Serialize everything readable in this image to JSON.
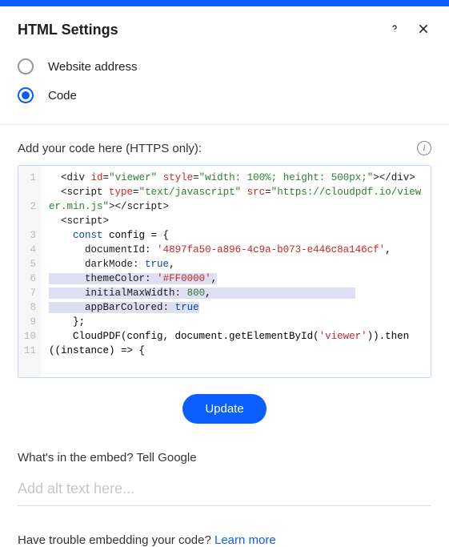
{
  "header": {
    "title": "HTML Settings"
  },
  "source": {
    "website_label": "Website address",
    "code_label": "Code",
    "selected": "code"
  },
  "code_section": {
    "label": "Add your code here (HTTPS only):"
  },
  "code_values": {
    "div_id": "viewer",
    "div_style": "width: 100%; height: 500px;",
    "script_type": "text/javascript",
    "script_src": "https://cloudpdf.io/viewer.min.js",
    "documentId": "4897fa50-a896-4c9a-b073-e446c8a146cf",
    "darkMode": "true",
    "themeColor": "#FF0000",
    "initialMaxWidth": "800",
    "appBarColored": "true",
    "getElementArg": "viewer"
  },
  "update_button": "Update",
  "alt": {
    "heading": "What's in the embed? Tell Google",
    "placeholder": "Add alt text here..."
  },
  "trouble": {
    "text": "Have trouble embedding your code? ",
    "link": "Learn more"
  }
}
